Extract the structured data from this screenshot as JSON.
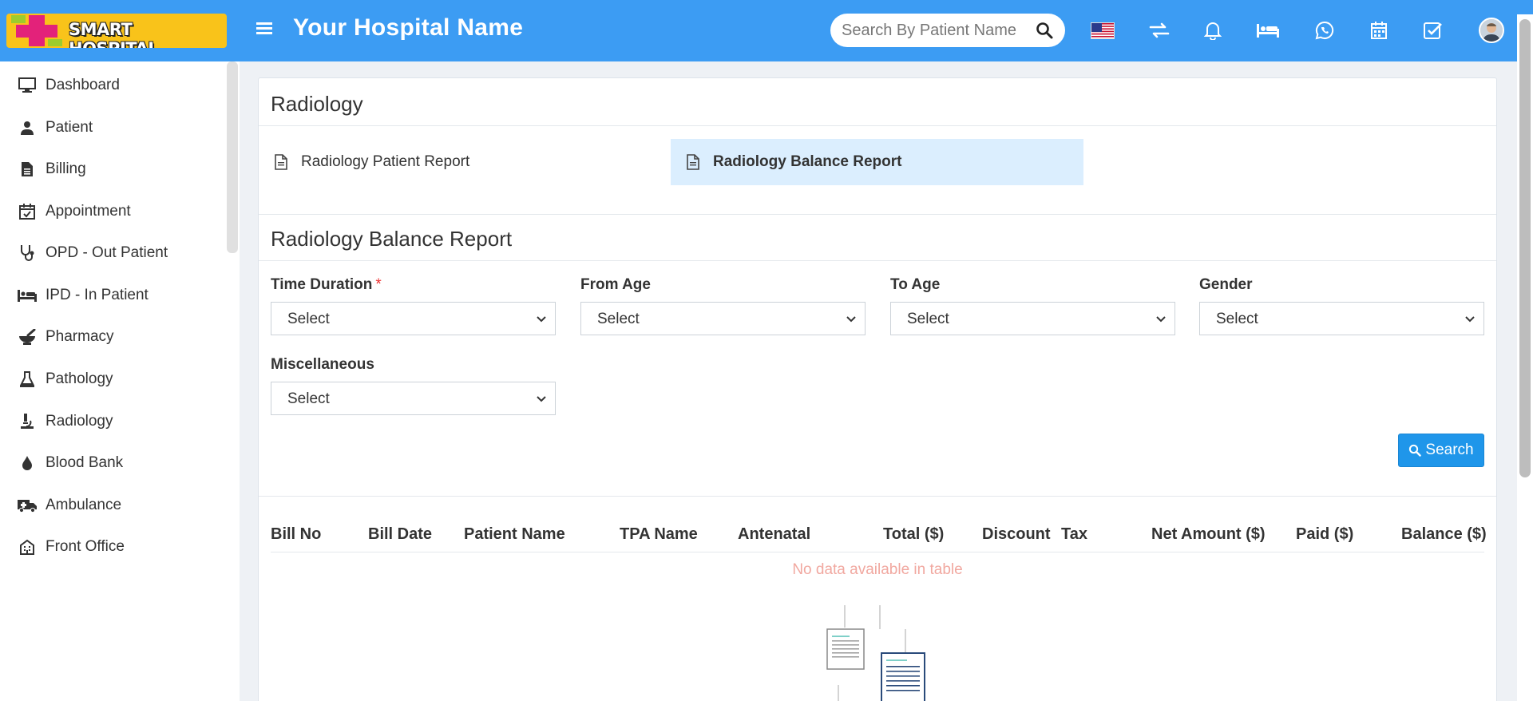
{
  "header": {
    "logo_text": "SMART HOSPITAL",
    "hospital_name": "Your Hospital Name",
    "search_placeholder": "Search By Patient Name",
    "accent_color": "#3c9cf3"
  },
  "sidebar": {
    "items": [
      {
        "label": "Dashboard",
        "icon": "monitor-icon"
      },
      {
        "label": "Patient",
        "icon": "user-icon"
      },
      {
        "label": "Billing",
        "icon": "document-icon"
      },
      {
        "label": "Appointment",
        "icon": "calendar-check-icon"
      },
      {
        "label": "OPD - Out Patient",
        "icon": "stethoscope-icon"
      },
      {
        "label": "IPD - In Patient",
        "icon": "bed-icon"
      },
      {
        "label": "Pharmacy",
        "icon": "mortar-pestle-icon"
      },
      {
        "label": "Pathology",
        "icon": "flask-icon"
      },
      {
        "label": "Radiology",
        "icon": "microscope-icon"
      },
      {
        "label": "Blood Bank",
        "icon": "drop-icon"
      },
      {
        "label": "Ambulance",
        "icon": "ambulance-icon"
      },
      {
        "label": "Front Office",
        "icon": "building-icon"
      }
    ]
  },
  "main": {
    "title": "Radiology",
    "reports": [
      {
        "label": "Radiology Patient Report",
        "active": false
      },
      {
        "label": "Radiology Balance Report",
        "active": true
      }
    ],
    "section_title": "Radiology Balance Report",
    "filters": {
      "time_duration": {
        "label": "Time Duration",
        "required_mark": "*",
        "value": "Select"
      },
      "from_age": {
        "label": "From Age",
        "value": "Select"
      },
      "to_age": {
        "label": "To Age",
        "value": "Select"
      },
      "gender": {
        "label": "Gender",
        "value": "Select"
      },
      "miscellaneous": {
        "label": "Miscellaneous",
        "value": "Select"
      }
    },
    "search_button": "Search",
    "table": {
      "columns": [
        "Bill No",
        "Bill Date",
        "Patient Name",
        "TPA Name",
        "Antenatal",
        "Total ($)",
        "Discount",
        "Tax",
        "Net Amount ($)",
        "Paid ($)",
        "Balance ($)"
      ],
      "empty_text": "No data available in table"
    }
  }
}
